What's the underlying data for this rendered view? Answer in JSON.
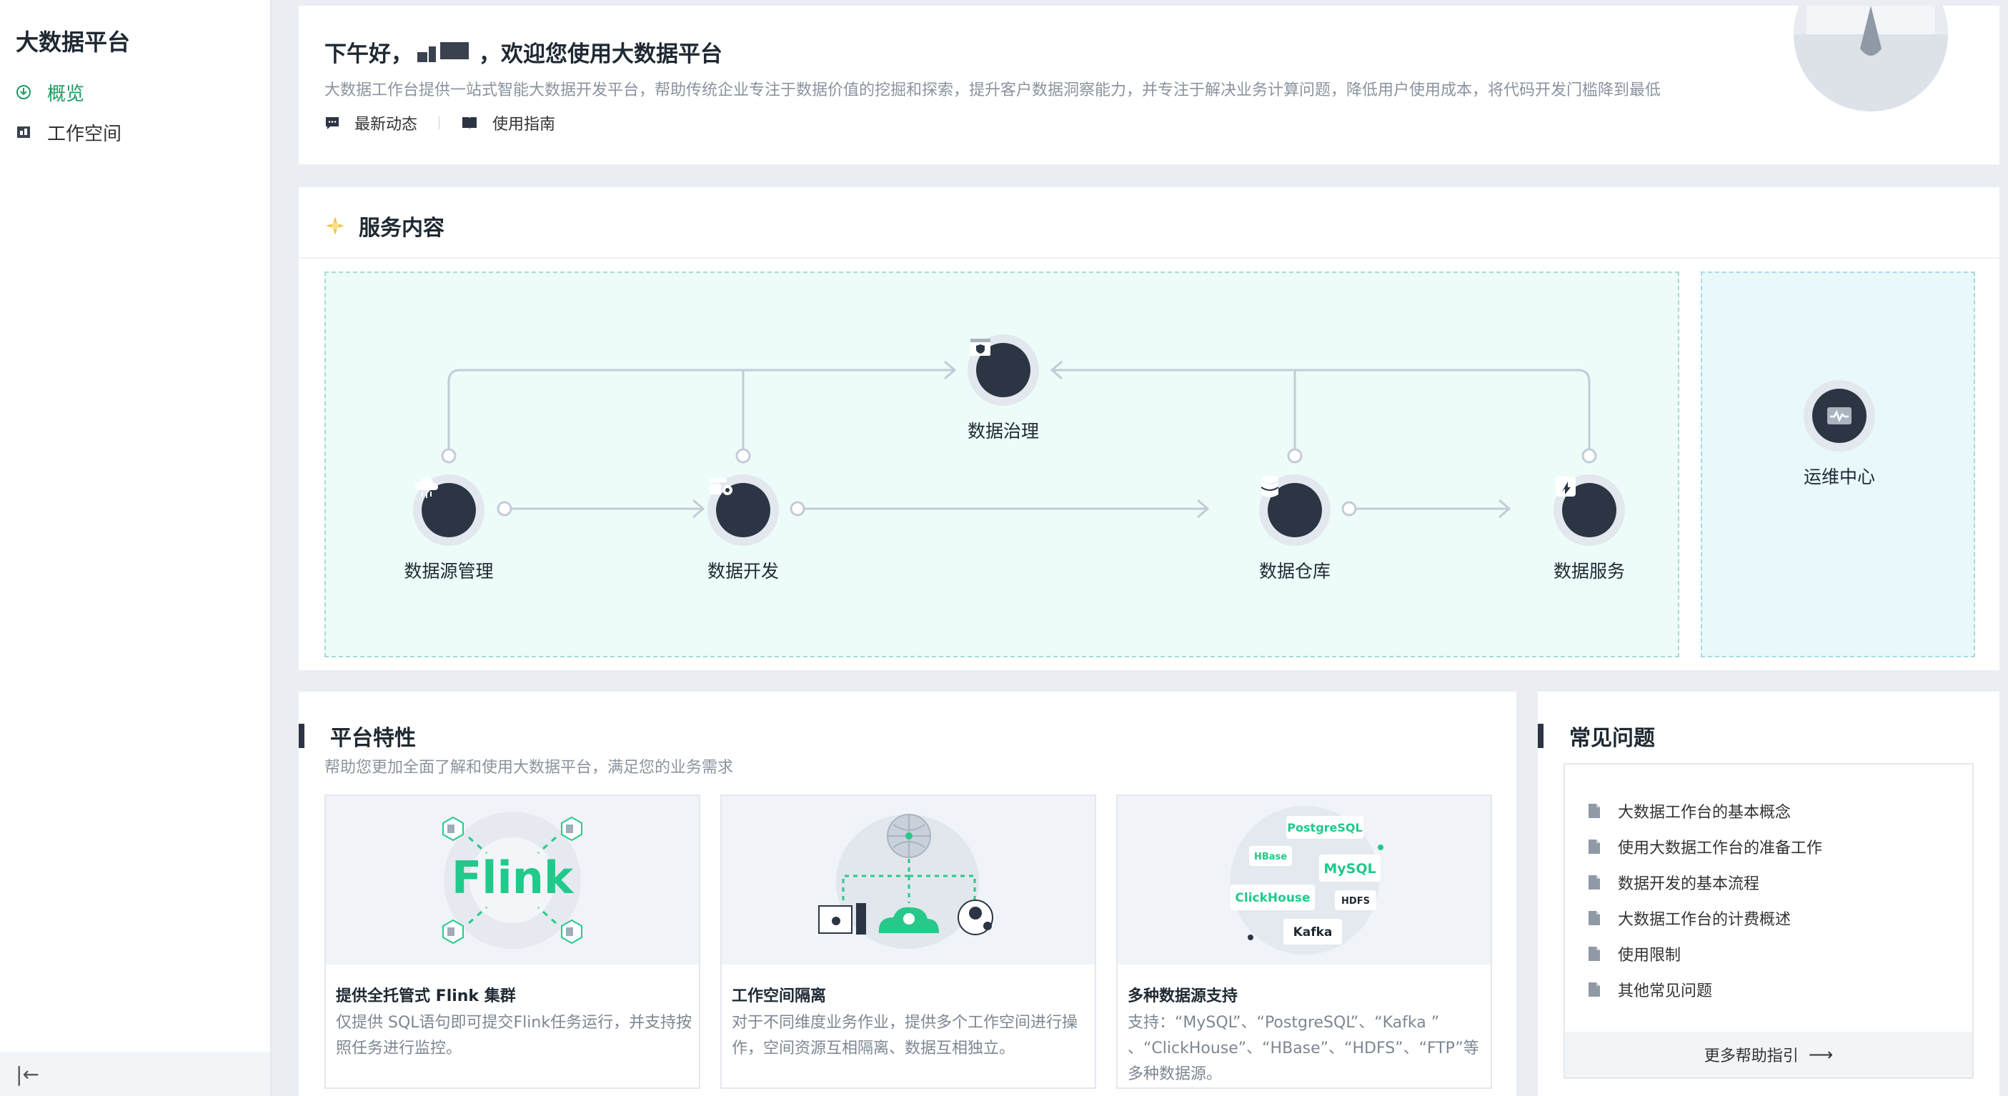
{
  "sidebar": {
    "brand": "大数据平台",
    "items": [
      {
        "label": "概览",
        "icon": "overview-icon",
        "active": true
      },
      {
        "label": "工作空间",
        "icon": "workspace-icon",
        "active": false
      }
    ],
    "collapse_icon": "|←"
  },
  "welcome": {
    "greeting_prefix": "下午好，",
    "greeting_suffix": "，欢迎您使用大数据平台",
    "description": "大数据工作台提供一站式智能大数据开发平台，帮助传统企业专注于数据价值的挖掘和探索，提升客户数据洞察能力，并专注于解决业务计算问题，降低用户使用成本，将代码开发门槛降到最低",
    "links": [
      {
        "label": "最新动态",
        "icon": "message-icon"
      },
      {
        "label": "使用指南",
        "icon": "book-icon"
      }
    ]
  },
  "services": {
    "title": "服务内容",
    "nodes": {
      "source": "数据源管理",
      "dev": "数据开发",
      "governance": "数据治理",
      "warehouse": "数据仓库",
      "service": "数据服务",
      "ops": "运维中心"
    }
  },
  "features": {
    "title": "平台特性",
    "subtitle": "帮助您更加全面了解和使用大数据平台，满足您的业务需求",
    "cards": [
      {
        "title": "提供全托管式 Flink 集群",
        "desc": "仅提供 SQL语句即可提交Flink任务运行，并支持按照任务进行监控。",
        "logo": "Flink"
      },
      {
        "title": "工作空间隔离",
        "desc": "对于不同维度业务作业，提供多个工作空间进行操作，空间资源互相隔离、数据互相独立。"
      },
      {
        "title": "多种数据源支持",
        "desc": "支持：“MySQL”、“PostgreSQL”、“Kafka ” 、“ClickHouse”、“HBase”、“HDFS”、“FTP”等多种数据源。",
        "tags": [
          "PostgreSQL",
          "HBase",
          "MySQL",
          "ClickHouse",
          "HDFS",
          "Kafka"
        ]
      }
    ]
  },
  "faq": {
    "title": "常见问题",
    "items": [
      "大数据工作台的基本概念",
      "使用大数据工作台的准备工作",
      "数据开发的基本流程",
      "大数据工作台的计费概述",
      "使用限制",
      "其他常见问题"
    ],
    "more": "更多帮助指引"
  },
  "colors": {
    "accent": "#1c9b63",
    "dark": "#2c3544"
  }
}
